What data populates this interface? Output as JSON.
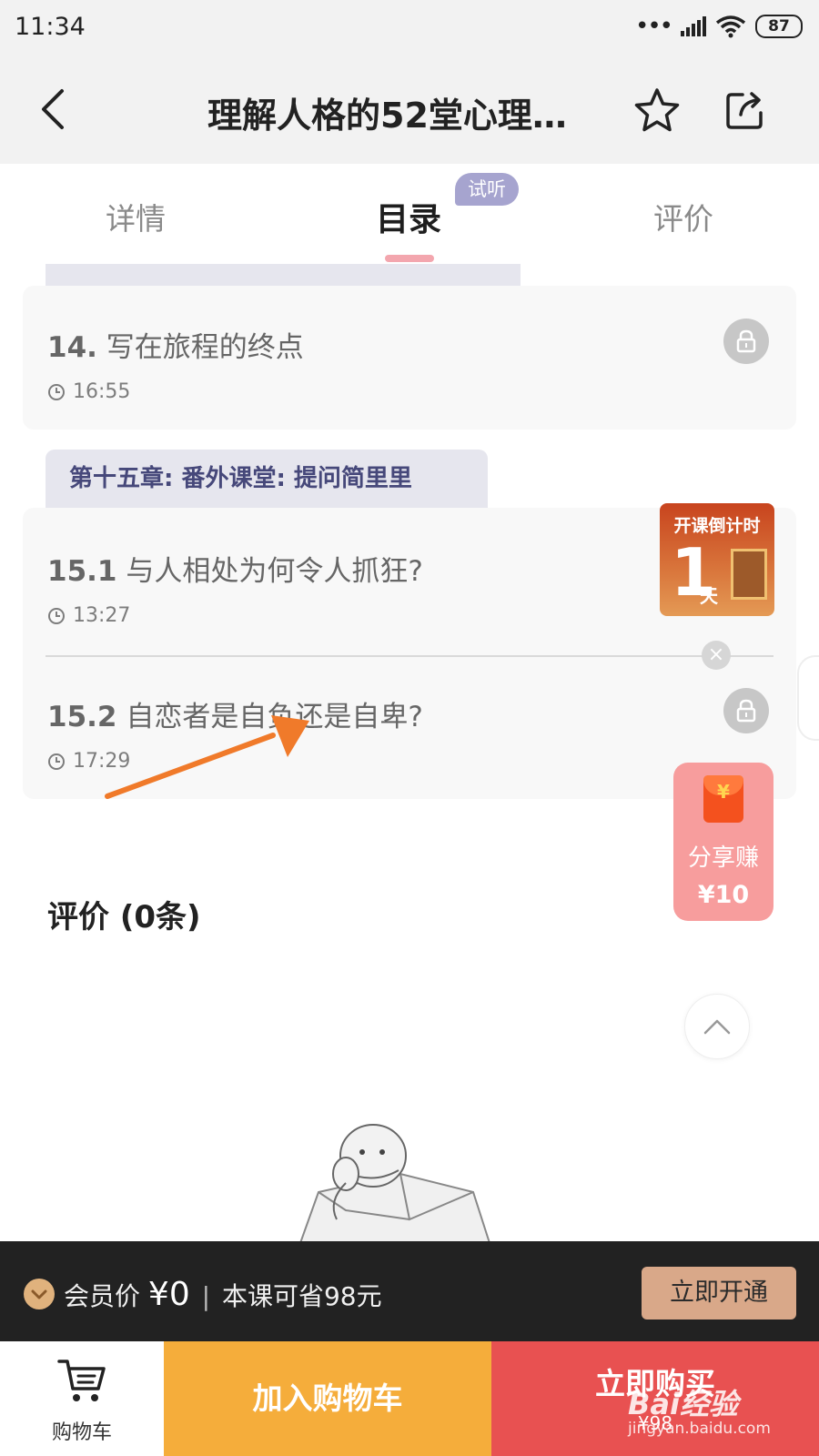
{
  "status": {
    "time": "11:34",
    "battery": "87"
  },
  "nav": {
    "title": "理解人格的52堂心理…"
  },
  "tabs": [
    {
      "label": "详情"
    },
    {
      "label": "目录"
    },
    {
      "label": "评价"
    }
  ],
  "trial_badge": "试听",
  "lessons": [
    {
      "number": "14.",
      "title": "写在旅程的终点",
      "duration": "16:55",
      "locked": true
    },
    {
      "number": "15.1",
      "title": "与人相处为何令人抓狂?",
      "duration": "13:27",
      "locked": false
    },
    {
      "number": "15.2",
      "title": "自恋者是自负还是自卑?",
      "duration": "17:29",
      "locked": true
    }
  ],
  "chapter": {
    "title": "第十五章: 番外课堂: 提问简里里"
  },
  "countdown": {
    "header": "开课倒计时",
    "number": "1",
    "unit": "天"
  },
  "share": {
    "label": "分享赚",
    "price": "¥10",
    "envelope_symbol": "¥"
  },
  "reviews": {
    "heading": "评价 (0条)"
  },
  "member": {
    "label": "会员价",
    "price": "¥0",
    "separator": "|",
    "save_text": "本课可省98元",
    "button": "立即开通"
  },
  "actions": {
    "cart_label": "购物车",
    "add_cart": "加入购物车",
    "buy_now": "立即购买",
    "buy_price": "¥98"
  },
  "watermark": {
    "brand": "Bai经验",
    "url": "jingyan.baidu.com"
  },
  "colors": {
    "accent_pink": "#f3a6ae",
    "chapter_text": "#46487a",
    "add_cart_bg": "#f5ad3b",
    "buy_bg": "#e85151",
    "member_btn": "#d9a889",
    "arrow": "#f07a2a"
  },
  "icons": {
    "back": "back-chevron-icon",
    "star": "star-icon",
    "share": "share-icon",
    "lock": "lock-icon",
    "clock": "clock-icon",
    "cart": "cart-icon",
    "up": "chevron-up-icon"
  }
}
